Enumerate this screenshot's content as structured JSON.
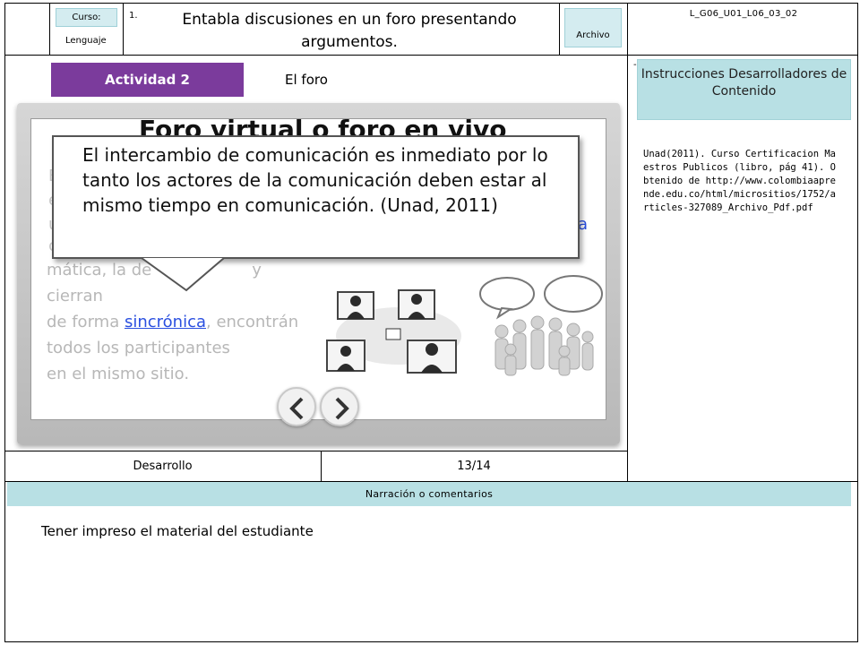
{
  "header": {
    "curso_label": "Curso:",
    "curso_value": "Lenguaje",
    "number": "1.",
    "lesson_title": "Entabla discusiones en un foro presentando argumentos.",
    "archivo": "Archivo",
    "code": "L_G06_U01_L06_03_02"
  },
  "activity": {
    "label": "Actividad 2",
    "title": "El foro"
  },
  "instructions": {
    "title": "Instrucciones Desarrolladores de Contenido",
    "reference": "Unad(2011). Curso Certificacion Maestros Publicos (libro, pág 41). Obtenido de http://www.colombiaaprende.edu.co/html/micrositios/1752/articles-327089_Archivo_Pdf.pdf"
  },
  "slide": {
    "heading_partial": "Foro virtual o foro en vivo",
    "line1": "mática, la de",
    "line1_end": "y cierran",
    "line2_start": "de forma ",
    "line2_link": "sincrónica",
    "line2_end": ", encontrán",
    "line3": "todos los participantes",
    "line4": "en el mismo sitio.",
    "frag_a": "a",
    "frag_c": "c",
    "frag_u": "u"
  },
  "callout": {
    "text": "El intercambio de comunicación es inmediato por lo tanto los actores de la comunicación deben estar al mismo tiempo en comunicación. (Unad, 2011)"
  },
  "nav": {
    "prev_icon": "chevron-left-icon",
    "next_icon": "chevron-right-icon"
  },
  "footer": {
    "section": "Desarrollo",
    "page": "13/14"
  },
  "narration": {
    "header": "Narración o comentarios",
    "text": "Tener impreso el material del estudiante"
  },
  "colors": {
    "activity_purple": "#7b3b9c",
    "teal_label": "#b8e0e4",
    "link_blue": "#2a4fe0"
  }
}
